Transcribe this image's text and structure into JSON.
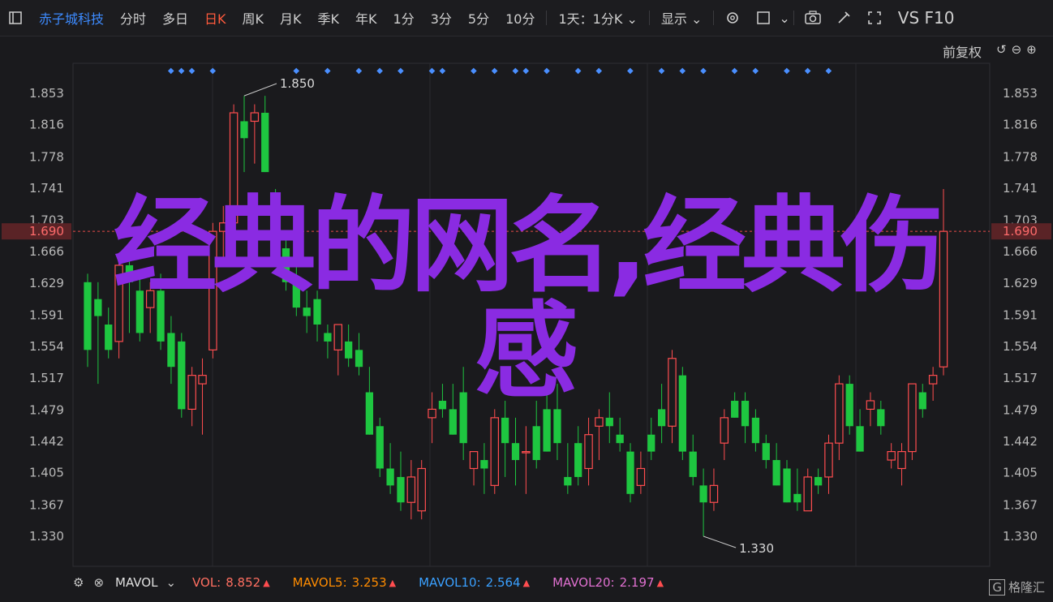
{
  "toolbar": {
    "name": "赤子城科技",
    "periods": [
      "分时",
      "多日",
      "日K",
      "周K",
      "月K",
      "季K",
      "年K",
      "1分",
      "3分",
      "5分",
      "10分"
    ],
    "active_period": "日K",
    "range_select": "1天：1分K",
    "display_label": "显示",
    "vs_label": "VS F10"
  },
  "adjust_label": "前复权",
  "overlay_text": {
    "line1": "经典的网名,经典伤",
    "line2": "感"
  },
  "legend": {
    "mavol_label": "MAVOL",
    "vol_label": "VOL:",
    "vol_value": "8.852",
    "mavol5_label": "MAVOL5:",
    "mavol5_value": "3.253",
    "mavol10_label": "MAVOL10:",
    "mavol10_value": "2.564",
    "mavol20_label": "MAVOL20:",
    "mavol20_value": "2.197",
    "watermark": "格隆汇"
  },
  "colors": {
    "up": "#ff4d4f",
    "down": "#1ec640",
    "accent": "#ff5a3c",
    "price_line": "#e84a4a",
    "overlay": "#8a2be2",
    "vol": "#ff6f61",
    "mavol5": "#ff8c00",
    "mavol10": "#3aa0ff",
    "mavol20": "#e070d0"
  },
  "chart_data": {
    "type": "candlestick",
    "y_ticks": [
      "1.853",
      "1.816",
      "1.778",
      "1.741",
      "1.703",
      "1.666",
      "1.629",
      "1.591",
      "1.554",
      "1.517",
      "1.479",
      "1.442",
      "1.405",
      "1.367",
      "1.330"
    ],
    "ylim": [
      1.33,
      1.853
    ],
    "current_price": "1.690",
    "annotations": [
      {
        "label": "1.850"
      },
      {
        "label": "1.330"
      }
    ],
    "candles": [
      {
        "o": 1.63,
        "h": 1.64,
        "l": 1.53,
        "c": 1.55
      },
      {
        "o": 1.61,
        "h": 1.63,
        "l": 1.51,
        "c": 1.59
      },
      {
        "o": 1.58,
        "h": 1.6,
        "l": 1.54,
        "c": 1.55
      },
      {
        "o": 1.56,
        "h": 1.66,
        "l": 1.54,
        "c": 1.65
      },
      {
        "o": 1.65,
        "h": 1.67,
        "l": 1.57,
        "c": 1.63
      },
      {
        "o": 1.62,
        "h": 1.64,
        "l": 1.56,
        "c": 1.57
      },
      {
        "o": 1.6,
        "h": 1.63,
        "l": 1.57,
        "c": 1.62
      },
      {
        "o": 1.62,
        "h": 1.64,
        "l": 1.55,
        "c": 1.56
      },
      {
        "o": 1.57,
        "h": 1.59,
        "l": 1.51,
        "c": 1.53
      },
      {
        "o": 1.56,
        "h": 1.57,
        "l": 1.47,
        "c": 1.48
      },
      {
        "o": 1.48,
        "h": 1.53,
        "l": 1.46,
        "c": 1.52
      },
      {
        "o": 1.51,
        "h": 1.54,
        "l": 1.45,
        "c": 1.52
      },
      {
        "o": 1.55,
        "h": 1.7,
        "l": 1.54,
        "c": 1.69
      },
      {
        "o": 1.69,
        "h": 1.72,
        "l": 1.65,
        "c": 1.7
      },
      {
        "o": 1.7,
        "h": 1.84,
        "l": 1.69,
        "c": 1.83
      },
      {
        "o": 1.82,
        "h": 1.85,
        "l": 1.76,
        "c": 1.8
      },
      {
        "o": 1.82,
        "h": 1.84,
        "l": 1.77,
        "c": 1.83
      },
      {
        "o": 1.83,
        "h": 1.85,
        "l": 1.76,
        "c": 1.76
      },
      {
        "o": 1.72,
        "h": 1.74,
        "l": 1.66,
        "c": 1.67
      },
      {
        "o": 1.67,
        "h": 1.69,
        "l": 1.62,
        "c": 1.63
      },
      {
        "o": 1.63,
        "h": 1.66,
        "l": 1.59,
        "c": 1.6
      },
      {
        "o": 1.6,
        "h": 1.62,
        "l": 1.57,
        "c": 1.59
      },
      {
        "o": 1.61,
        "h": 1.62,
        "l": 1.56,
        "c": 1.58
      },
      {
        "o": 1.57,
        "h": 1.58,
        "l": 1.54,
        "c": 1.56
      },
      {
        "o": 1.55,
        "h": 1.58,
        "l": 1.52,
        "c": 1.58
      },
      {
        "o": 1.56,
        "h": 1.58,
        "l": 1.53,
        "c": 1.54
      },
      {
        "o": 1.55,
        "h": 1.57,
        "l": 1.52,
        "c": 1.53
      },
      {
        "o": 1.5,
        "h": 1.53,
        "l": 1.45,
        "c": 1.45
      },
      {
        "o": 1.46,
        "h": 1.47,
        "l": 1.4,
        "c": 1.41
      },
      {
        "o": 1.41,
        "h": 1.44,
        "l": 1.38,
        "c": 1.39
      },
      {
        "o": 1.4,
        "h": 1.43,
        "l": 1.36,
        "c": 1.37
      },
      {
        "o": 1.37,
        "h": 1.42,
        "l": 1.35,
        "c": 1.4
      },
      {
        "o": 1.36,
        "h": 1.42,
        "l": 1.35,
        "c": 1.41
      },
      {
        "o": 1.47,
        "h": 1.5,
        "l": 1.44,
        "c": 1.48
      },
      {
        "o": 1.49,
        "h": 1.51,
        "l": 1.47,
        "c": 1.48
      },
      {
        "o": 1.48,
        "h": 1.51,
        "l": 1.45,
        "c": 1.45
      },
      {
        "o": 1.5,
        "h": 1.53,
        "l": 1.42,
        "c": 1.44
      },
      {
        "o": 1.41,
        "h": 1.43,
        "l": 1.39,
        "c": 1.43
      },
      {
        "o": 1.42,
        "h": 1.44,
        "l": 1.38,
        "c": 1.41
      },
      {
        "o": 1.39,
        "h": 1.48,
        "l": 1.38,
        "c": 1.47
      },
      {
        "o": 1.47,
        "h": 1.49,
        "l": 1.4,
        "c": 1.44
      },
      {
        "o": 1.44,
        "h": 1.47,
        "l": 1.39,
        "c": 1.42
      },
      {
        "o": 1.43,
        "h": 1.46,
        "l": 1.38,
        "c": 1.43
      },
      {
        "o": 1.46,
        "h": 1.49,
        "l": 1.41,
        "c": 1.42
      },
      {
        "o": 1.48,
        "h": 1.5,
        "l": 1.43,
        "c": 1.43
      },
      {
        "o": 1.48,
        "h": 1.51,
        "l": 1.42,
        "c": 1.44
      },
      {
        "o": 1.4,
        "h": 1.44,
        "l": 1.38,
        "c": 1.39
      },
      {
        "o": 1.44,
        "h": 1.46,
        "l": 1.39,
        "c": 1.4
      },
      {
        "o": 1.41,
        "h": 1.47,
        "l": 1.39,
        "c": 1.45
      },
      {
        "o": 1.46,
        "h": 1.48,
        "l": 1.42,
        "c": 1.47
      },
      {
        "o": 1.47,
        "h": 1.5,
        "l": 1.44,
        "c": 1.46
      },
      {
        "o": 1.45,
        "h": 1.47,
        "l": 1.43,
        "c": 1.44
      },
      {
        "o": 1.43,
        "h": 1.44,
        "l": 1.37,
        "c": 1.38
      },
      {
        "o": 1.39,
        "h": 1.43,
        "l": 1.38,
        "c": 1.41
      },
      {
        "o": 1.45,
        "h": 1.47,
        "l": 1.42,
        "c": 1.43
      },
      {
        "o": 1.48,
        "h": 1.51,
        "l": 1.44,
        "c": 1.46
      },
      {
        "o": 1.46,
        "h": 1.55,
        "l": 1.44,
        "c": 1.54
      },
      {
        "o": 1.52,
        "h": 1.53,
        "l": 1.42,
        "c": 1.43
      },
      {
        "o": 1.43,
        "h": 1.45,
        "l": 1.39,
        "c": 1.4
      },
      {
        "o": 1.39,
        "h": 1.41,
        "l": 1.33,
        "c": 1.37
      },
      {
        "o": 1.37,
        "h": 1.41,
        "l": 1.36,
        "c": 1.39
      },
      {
        "o": 1.44,
        "h": 1.48,
        "l": 1.42,
        "c": 1.47
      },
      {
        "o": 1.49,
        "h": 1.5,
        "l": 1.47,
        "c": 1.47
      },
      {
        "o": 1.49,
        "h": 1.5,
        "l": 1.44,
        "c": 1.46
      },
      {
        "o": 1.47,
        "h": 1.48,
        "l": 1.43,
        "c": 1.44
      },
      {
        "o": 1.44,
        "h": 1.45,
        "l": 1.41,
        "c": 1.42
      },
      {
        "o": 1.42,
        "h": 1.44,
        "l": 1.39,
        "c": 1.39
      },
      {
        "o": 1.41,
        "h": 1.42,
        "l": 1.37,
        "c": 1.37
      },
      {
        "o": 1.38,
        "h": 1.41,
        "l": 1.36,
        "c": 1.37
      },
      {
        "o": 1.36,
        "h": 1.41,
        "l": 1.36,
        "c": 1.4
      },
      {
        "o": 1.4,
        "h": 1.41,
        "l": 1.38,
        "c": 1.39
      },
      {
        "o": 1.4,
        "h": 1.45,
        "l": 1.38,
        "c": 1.44
      },
      {
        "o": 1.44,
        "h": 1.52,
        "l": 1.42,
        "c": 1.51
      },
      {
        "o": 1.51,
        "h": 1.52,
        "l": 1.45,
        "c": 1.46
      },
      {
        "o": 1.46,
        "h": 1.48,
        "l": 1.43,
        "c": 1.43
      },
      {
        "o": 1.48,
        "h": 1.5,
        "l": 1.46,
        "c": 1.49
      },
      {
        "o": 1.48,
        "h": 1.49,
        "l": 1.45,
        "c": 1.46
      },
      {
        "o": 1.42,
        "h": 1.44,
        "l": 1.41,
        "c": 1.43
      },
      {
        "o": 1.41,
        "h": 1.44,
        "l": 1.39,
        "c": 1.43
      },
      {
        "o": 1.43,
        "h": 1.51,
        "l": 1.42,
        "c": 1.51
      },
      {
        "o": 1.5,
        "h": 1.51,
        "l": 1.47,
        "c": 1.48
      },
      {
        "o": 1.51,
        "h": 1.53,
        "l": 1.49,
        "c": 1.52
      },
      {
        "o": 1.53,
        "h": 1.74,
        "l": 1.52,
        "c": 1.69
      }
    ]
  }
}
